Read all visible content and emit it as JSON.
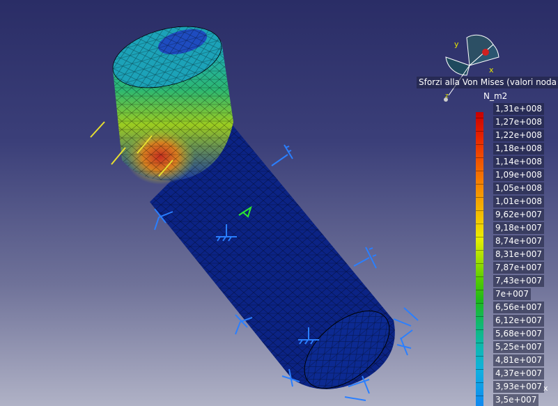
{
  "legend": {
    "title": "Sforzi alla Von Mises (valori noda",
    "unit": "N_m2",
    "values": [
      "1,31e+008",
      "1,27e+008",
      "1,22e+008",
      "1,18e+008",
      "1,14e+008",
      "1,09e+008",
      "1,05e+008",
      "1,01e+008",
      "9,62e+007",
      "9,18e+007",
      "8,74e+007",
      "8,31e+007",
      "7,87e+007",
      "7,43e+007",
      "7e+007",
      "6,56e+007",
      "6,12e+007",
      "5,68e+007",
      "5,25e+007",
      "4,81e+007",
      "4,37e+007",
      "3,93e+007",
      "3,5e+007"
    ],
    "close_label": "x"
  },
  "compass": {
    "y_label": "y",
    "x_label": "x",
    "z_label": "z"
  },
  "colors": {
    "mesh_low": "#0a1e7a",
    "stress_high": "#c8281e",
    "constraint": "#2a7fff",
    "load_arrow": "#e8e030"
  }
}
